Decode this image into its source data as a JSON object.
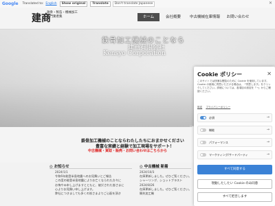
{
  "translate_bar": {
    "logo": "Google",
    "label": "Translated to:",
    "language": "English",
    "show_original": "Show original",
    "translate_btn": "Translate",
    "default_lang": "Don't translate Japanese",
    "close": "✕"
  },
  "header": {
    "logo_main": "建商",
    "logo_sub1": "鉄骨・製缶・機械加工",
    "logo_sub2": "専門業者集",
    "nav": [
      "ホーム",
      "会社概要",
      "中古機械在庫情報",
      "お問い合わせ"
    ],
    "active_index": 0
  },
  "hero": {
    "line1": "鉄骨加工機械のことなら",
    "line2": "建商有限会社",
    "line3": "Kensyo Corporation"
  },
  "intro": {
    "line1": "鉄骨加工機械のことならわたしたちにおまかせください",
    "line2": "豊富な実績と経験で加工現場をサポート！",
    "line3": "中古機械・買取・販売・お問い合わせはこちらから"
  },
  "news": {
    "title": "お知らせ",
    "items": [
      "2024/1/1",
      "令和6年能登半島地震へのお見舞いとご報告",
      "この度の能登半島地震によりお亡くなられた方々に",
      "お悔やみ申し上げますとともに、被災された皆さまに",
      "心よりお見舞い申し上げます。",
      "弊社につきましても多くの皆さまよりご心配を頂き"
    ]
  },
  "stock": {
    "title": "中古機械 新着",
    "items": [
      "2024/10/3",
      "在庫更新しました。ぜひご覧ください。",
      "シャーリング、ショットブラスト",
      "2024/8/26",
      "在庫更新しました。ぜひご覧ください。",
      "開先加工機"
    ]
  },
  "side_tab": "En",
  "cookie": {
    "title": "Cookie ポリシー",
    "close": "✕",
    "description": "このサイトでは快適な閲覧のために Cookie を使用しています。Cookie の使用に同意いただける場合は、「同意します」をクリックしてください。詳細については、各項目の設定を「→」からご確認ください。",
    "links": [
      "設定",
      "プライバシーポリシー"
    ],
    "categories": [
      {
        "label": "必須",
        "on": true
      },
      {
        "label": "機能",
        "on": false
      },
      {
        "label": "パフォーマンス",
        "on": false
      },
      {
        "label": "マーケティング/サードパーティ",
        "on": false
      }
    ],
    "arrow": "→",
    "accept_all": "すべて同意する",
    "accept_required": "現動したしたい Cookie のみ同意",
    "reject_all": "すべて拒否します"
  }
}
